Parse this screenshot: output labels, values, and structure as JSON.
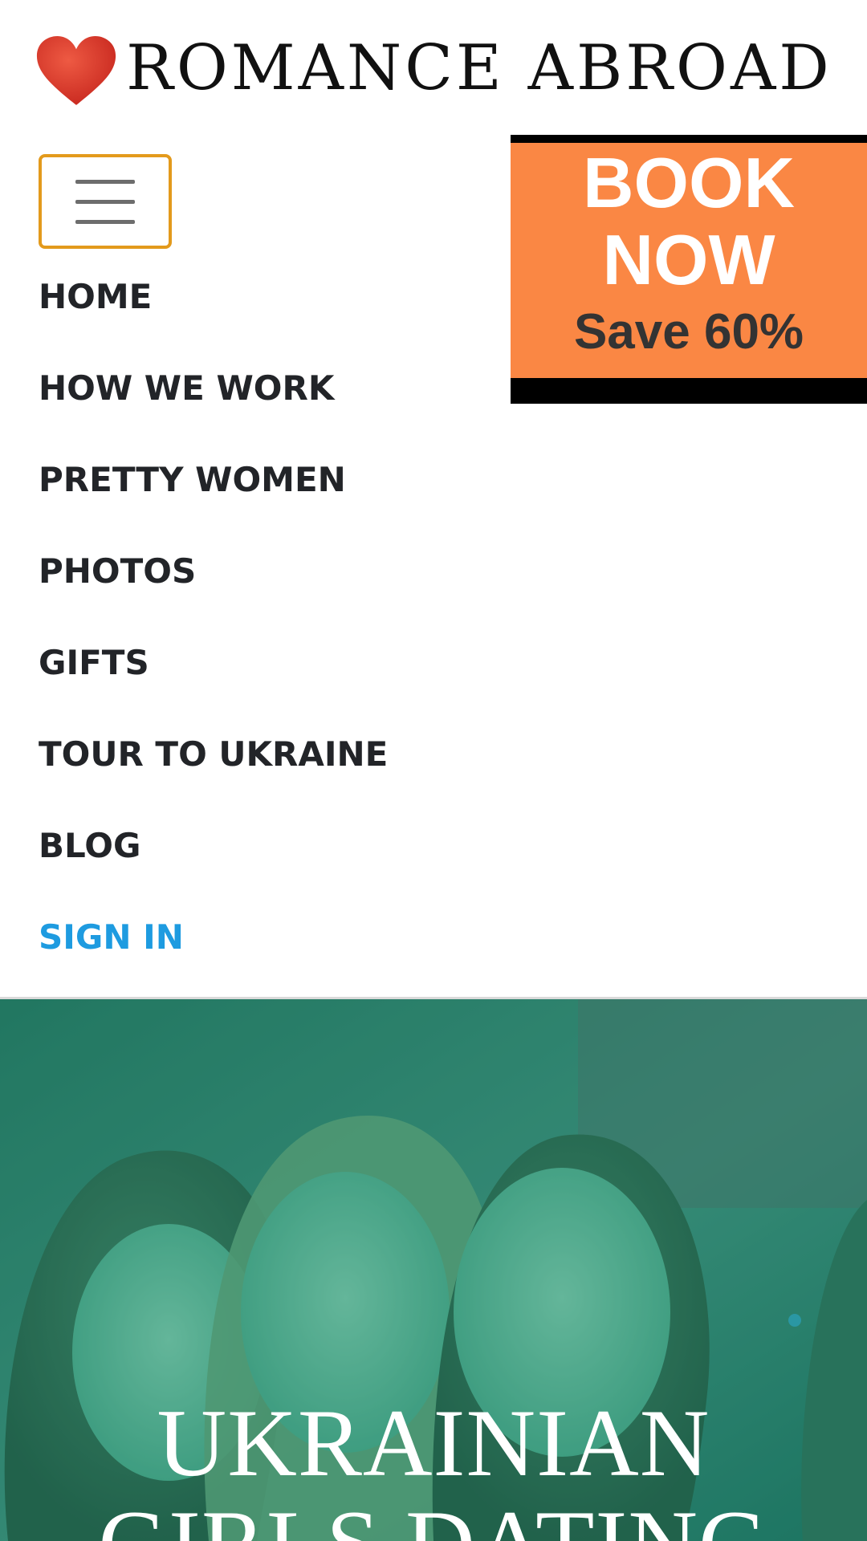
{
  "header": {
    "logo_text": "ROMANCE ABROAD",
    "logo_icon": "heart-icon",
    "logo_color": "#d9362c"
  },
  "menu_toggle": {
    "icon": "hamburger-icon",
    "border_color": "#e39a1c"
  },
  "promo": {
    "line1": "BOOK",
    "line2": "NOW",
    "save": "Save 60%",
    "background": "#fa8744"
  },
  "nav": {
    "items": [
      {
        "label": "HOME"
      },
      {
        "label": "HOW WE WORK"
      },
      {
        "label": "PRETTY WOMEN"
      },
      {
        "label": "PHOTOS"
      },
      {
        "label": "GIFTS"
      },
      {
        "label": "TOUR TO UKRAINE"
      },
      {
        "label": "BLOG"
      },
      {
        "label": "SIGN IN"
      }
    ],
    "signin_color": "#1e9be0"
  },
  "hero": {
    "title_line1": "UKRAINIAN",
    "title_line2": "GIRLS DATING",
    "overlay_color": "#1d8a6e"
  }
}
